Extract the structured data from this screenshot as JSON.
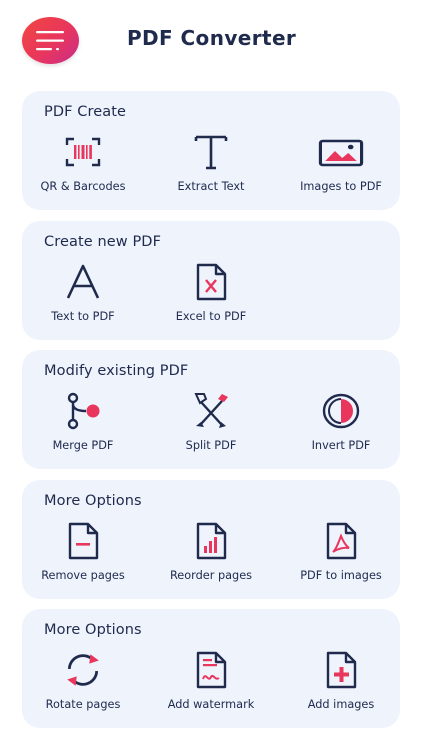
{
  "header": {
    "title": "PDF Converter",
    "menu_icon": "menu-icon"
  },
  "accent": "#e8365d",
  "primary": "#1f2a4d",
  "card_bg": "#eef3fc",
  "sections": [
    {
      "title": "PDF Create",
      "items": [
        {
          "label": "QR & Barcodes",
          "icon": "barcode-icon"
        },
        {
          "label": "Extract Text",
          "icon": "text-t-icon"
        },
        {
          "label": "Images to PDF",
          "icon": "image-icon"
        }
      ]
    },
    {
      "title": "Create new PDF",
      "items": [
        {
          "label": "Text to PDF",
          "icon": "letter-a-icon"
        },
        {
          "label": "Excel to PDF",
          "icon": "excel-file-icon"
        }
      ]
    },
    {
      "title": "Modify existing PDF",
      "items": [
        {
          "label": "Merge PDF",
          "icon": "merge-icon"
        },
        {
          "label": "Split PDF",
          "icon": "split-icon"
        },
        {
          "label": "Invert PDF",
          "icon": "invert-icon"
        }
      ]
    },
    {
      "title": "More Options",
      "items": [
        {
          "label": "Remove pages",
          "icon": "remove-page-icon"
        },
        {
          "label": "Reorder pages",
          "icon": "reorder-pages-icon"
        },
        {
          "label": "PDF to images",
          "icon": "pdf-file-icon"
        }
      ]
    },
    {
      "title": "More Options",
      "items": [
        {
          "label": "Rotate pages",
          "icon": "rotate-icon"
        },
        {
          "label": "Add watermark",
          "icon": "watermark-icon"
        },
        {
          "label": "Add images",
          "icon": "add-image-icon"
        }
      ]
    }
  ]
}
